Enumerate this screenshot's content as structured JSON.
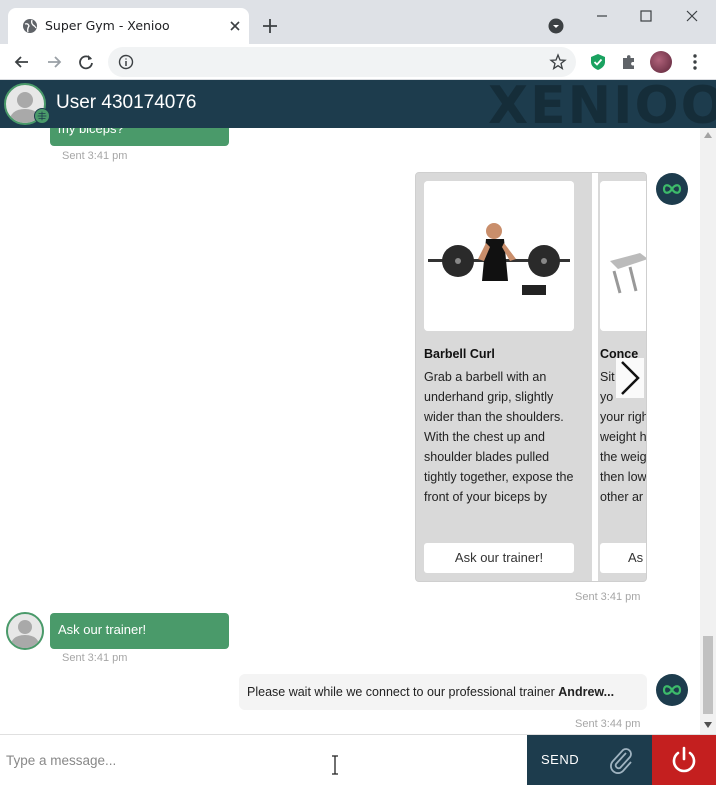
{
  "browser": {
    "tab_title": "Super Gym - Xenioo",
    "colors": {
      "tabbar": "#dee1e6",
      "accent_shield": "#1aa260"
    }
  },
  "header": {
    "title": "User 430174076",
    "watermark": "XENIOO",
    "color": "#1d3c4d"
  },
  "messages": {
    "first_user": {
      "text": "my biceps?",
      "time": "Sent 3:41 pm"
    },
    "carousel": {
      "time": "Sent 3:41 pm",
      "cards": [
        {
          "title": "Barbell Curl",
          "text": "Grab a barbell with an underhand grip, slightly wider than the shoulders. With the chest up and shoulder blades pulled tightly together, expose the front of your biceps by",
          "button": "Ask our trainer!"
        },
        {
          "title": "Conce",
          "text_lines": [
            "Sit",
            "yo",
            "your righ",
            "weight h",
            "the weig",
            "then low",
            "other ar"
          ],
          "button": "As"
        }
      ]
    },
    "second_user": {
      "text": "Ask our trainer!",
      "time": "Sent 3:41 pm"
    },
    "bot_wait": {
      "text": "Please wait while we connect to our professional trainer ",
      "bold": "Andrew...",
      "time": "Sent 3:44 pm"
    }
  },
  "composer": {
    "placeholder": "Type a message...",
    "send_label": "SEND",
    "send_color": "#1d3c4d",
    "power_color": "#c41f1f"
  },
  "accent_green": "#4a9a6a"
}
